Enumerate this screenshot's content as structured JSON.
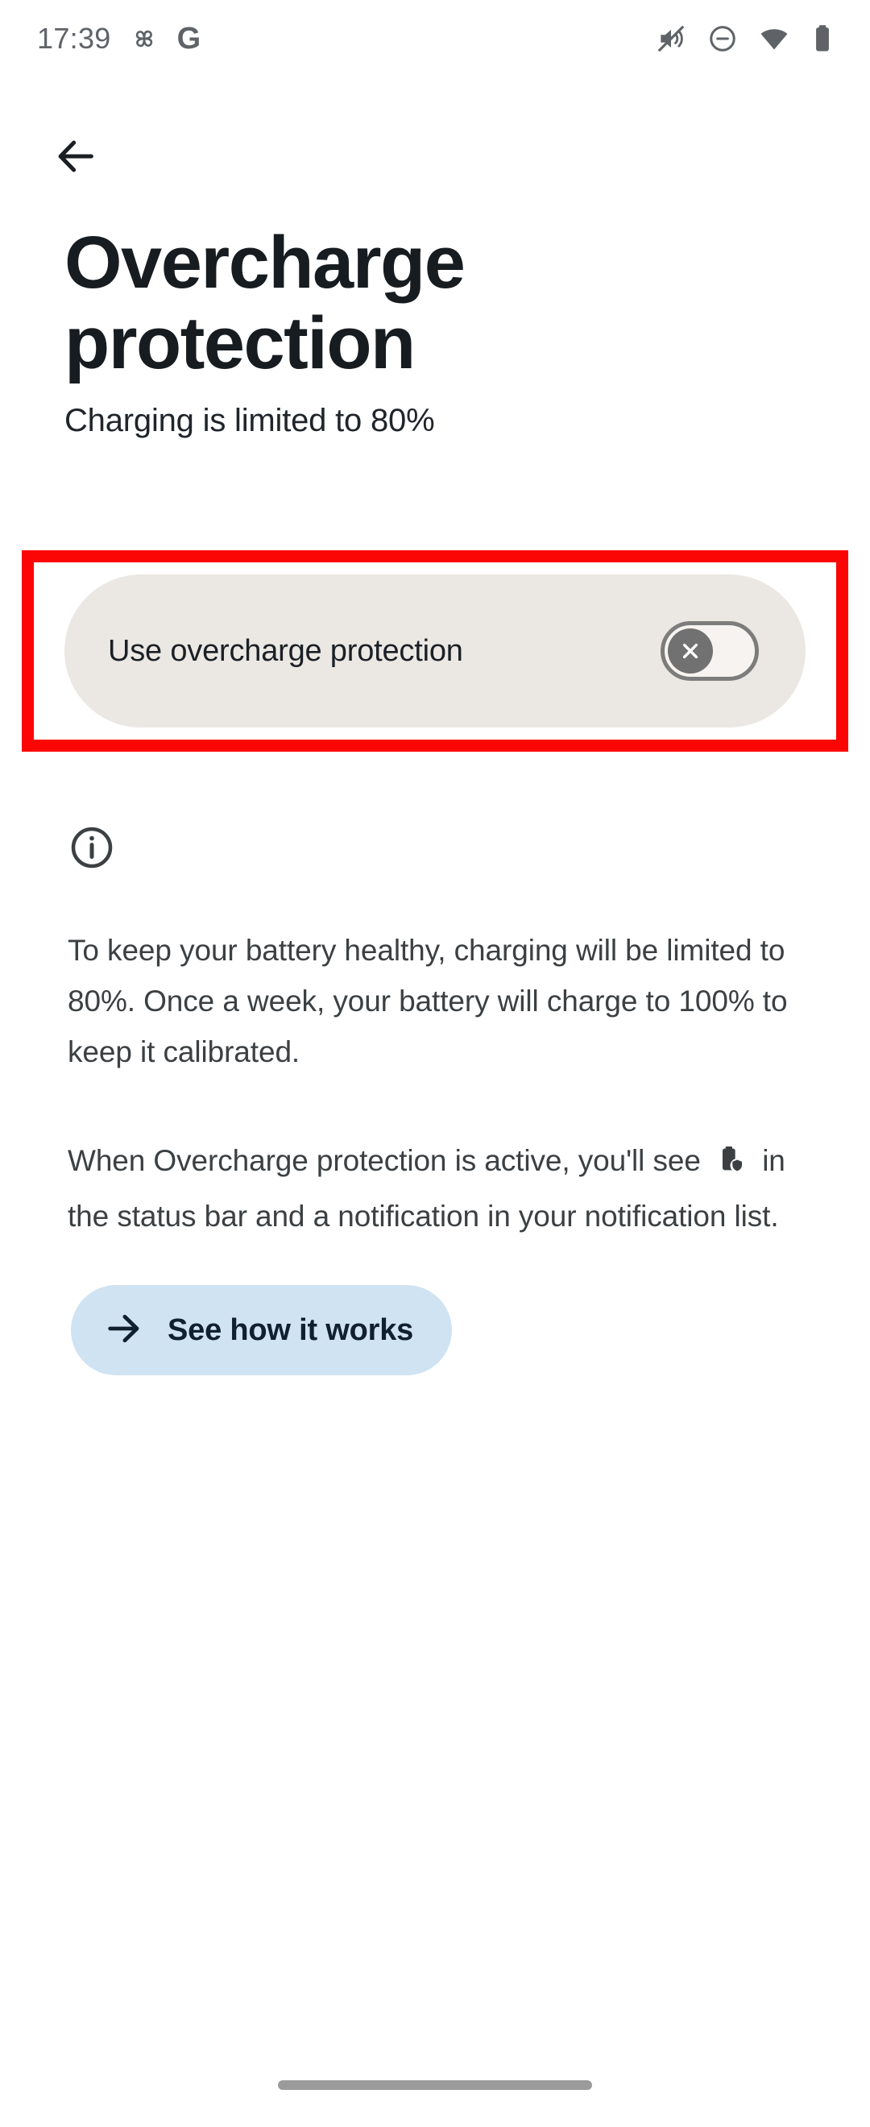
{
  "status_bar": {
    "time": "17:39",
    "left_icons": [
      "pinwheel-icon",
      "google-g-icon"
    ],
    "right_icons": [
      "volume-muted-icon",
      "do-not-disturb-icon",
      "wifi-icon",
      "battery-icon"
    ],
    "google_glyph": "G",
    "icon_color": "#5f6368"
  },
  "nav": {
    "back_icon": "arrow-back-icon"
  },
  "header": {
    "title": "Overcharge protection",
    "subtitle": "Charging is limited to 80%"
  },
  "toggle_row": {
    "label": "Use overcharge protection",
    "state": "off",
    "thumb_glyph": "x-mark",
    "card_color": "#ebe8e4",
    "highlight_color": "#fb0605"
  },
  "info": {
    "icon": "info-circle-icon",
    "paragraph_1": "To keep your battery healthy, charging will be limited to 80%. Once a week, your battery will charge to 100% to keep it calibrated.",
    "paragraph_2_before": "When Overcharge protection is active, you'll see",
    "paragraph_2_icon": "battery-shield-icon",
    "paragraph_2_after": "in the status bar and a notification in your notification list."
  },
  "cta": {
    "label": "See how it works",
    "icon": "arrow-forward-icon",
    "bg_color": "#cfe3f3",
    "text_color": "#10202e"
  },
  "system_nav": {
    "handle": "gesture-nav-handle"
  }
}
